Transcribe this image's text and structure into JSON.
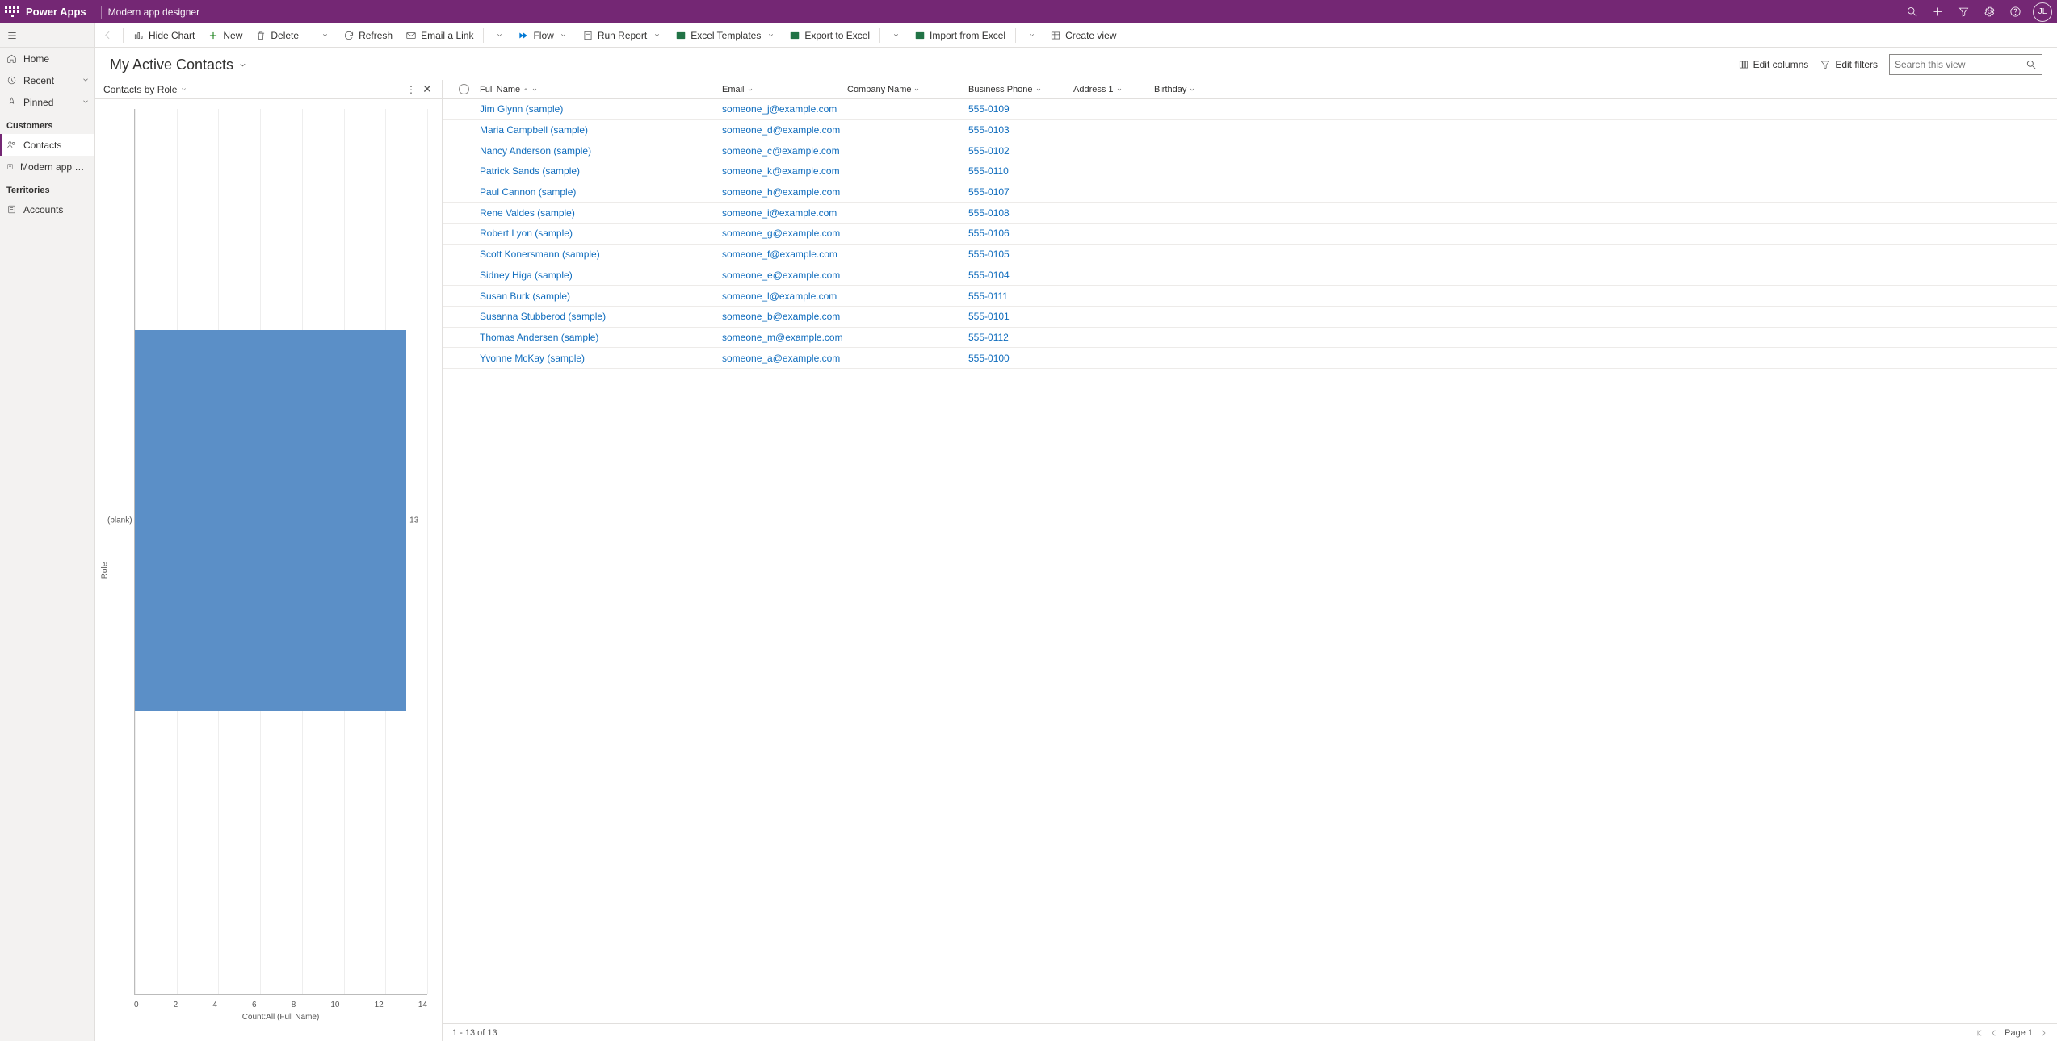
{
  "topbar": {
    "brand": "Power Apps",
    "subtitle": "Modern app designer",
    "avatar_initials": "JL"
  },
  "sidebar": {
    "home": "Home",
    "recent": "Recent",
    "pinned": "Pinned",
    "section_customers": "Customers",
    "contacts": "Contacts",
    "modern_app_designer": "Modern app designe…",
    "section_territories": "Territories",
    "accounts": "Accounts"
  },
  "commands": {
    "hide_chart": "Hide Chart",
    "new": "New",
    "delete": "Delete",
    "refresh": "Refresh",
    "email_link": "Email a Link",
    "flow": "Flow",
    "run_report": "Run Report",
    "excel_templates": "Excel Templates",
    "export_excel": "Export to Excel",
    "import_excel": "Import from Excel",
    "create_view": "Create view"
  },
  "view": {
    "title": "My Active Contacts",
    "edit_columns": "Edit columns",
    "edit_filters": "Edit filters",
    "search_placeholder": "Search this view"
  },
  "chart": {
    "title": "Contacts by Role"
  },
  "chart_data": {
    "type": "bar",
    "orientation": "horizontal",
    "categories": [
      "(blank)"
    ],
    "values": [
      13
    ],
    "xlabel": "Count:All (Full Name)",
    "ylabel": "Role",
    "xlim": [
      0,
      14
    ],
    "xticks": [
      0,
      2,
      4,
      6,
      8,
      10,
      12,
      14
    ]
  },
  "grid": {
    "columns": {
      "full_name": "Full Name",
      "email": "Email",
      "company": "Company Name",
      "phone": "Business Phone",
      "address": "Address 1",
      "birthday": "Birthday"
    },
    "rows": [
      {
        "name": "Jim Glynn (sample)",
        "email": "someone_j@example.com",
        "phone": "555-0109"
      },
      {
        "name": "Maria Campbell (sample)",
        "email": "someone_d@example.com",
        "phone": "555-0103"
      },
      {
        "name": "Nancy Anderson (sample)",
        "email": "someone_c@example.com",
        "phone": "555-0102"
      },
      {
        "name": "Patrick Sands (sample)",
        "email": "someone_k@example.com",
        "phone": "555-0110"
      },
      {
        "name": "Paul Cannon (sample)",
        "email": "someone_h@example.com",
        "phone": "555-0107"
      },
      {
        "name": "Rene Valdes (sample)",
        "email": "someone_i@example.com",
        "phone": "555-0108"
      },
      {
        "name": "Robert Lyon (sample)",
        "email": "someone_g@example.com",
        "phone": "555-0106"
      },
      {
        "name": "Scott Konersmann (sample)",
        "email": "someone_f@example.com",
        "phone": "555-0105"
      },
      {
        "name": "Sidney Higa (sample)",
        "email": "someone_e@example.com",
        "phone": "555-0104"
      },
      {
        "name": "Susan Burk (sample)",
        "email": "someone_l@example.com",
        "phone": "555-0111"
      },
      {
        "name": "Susanna Stubberod (sample)",
        "email": "someone_b@example.com",
        "phone": "555-0101"
      },
      {
        "name": "Thomas Andersen (sample)",
        "email": "someone_m@example.com",
        "phone": "555-0112"
      },
      {
        "name": "Yvonne McKay (sample)",
        "email": "someone_a@example.com",
        "phone": "555-0100"
      }
    ],
    "footer_range": "1 - 13 of 13",
    "footer_page": "Page 1"
  }
}
